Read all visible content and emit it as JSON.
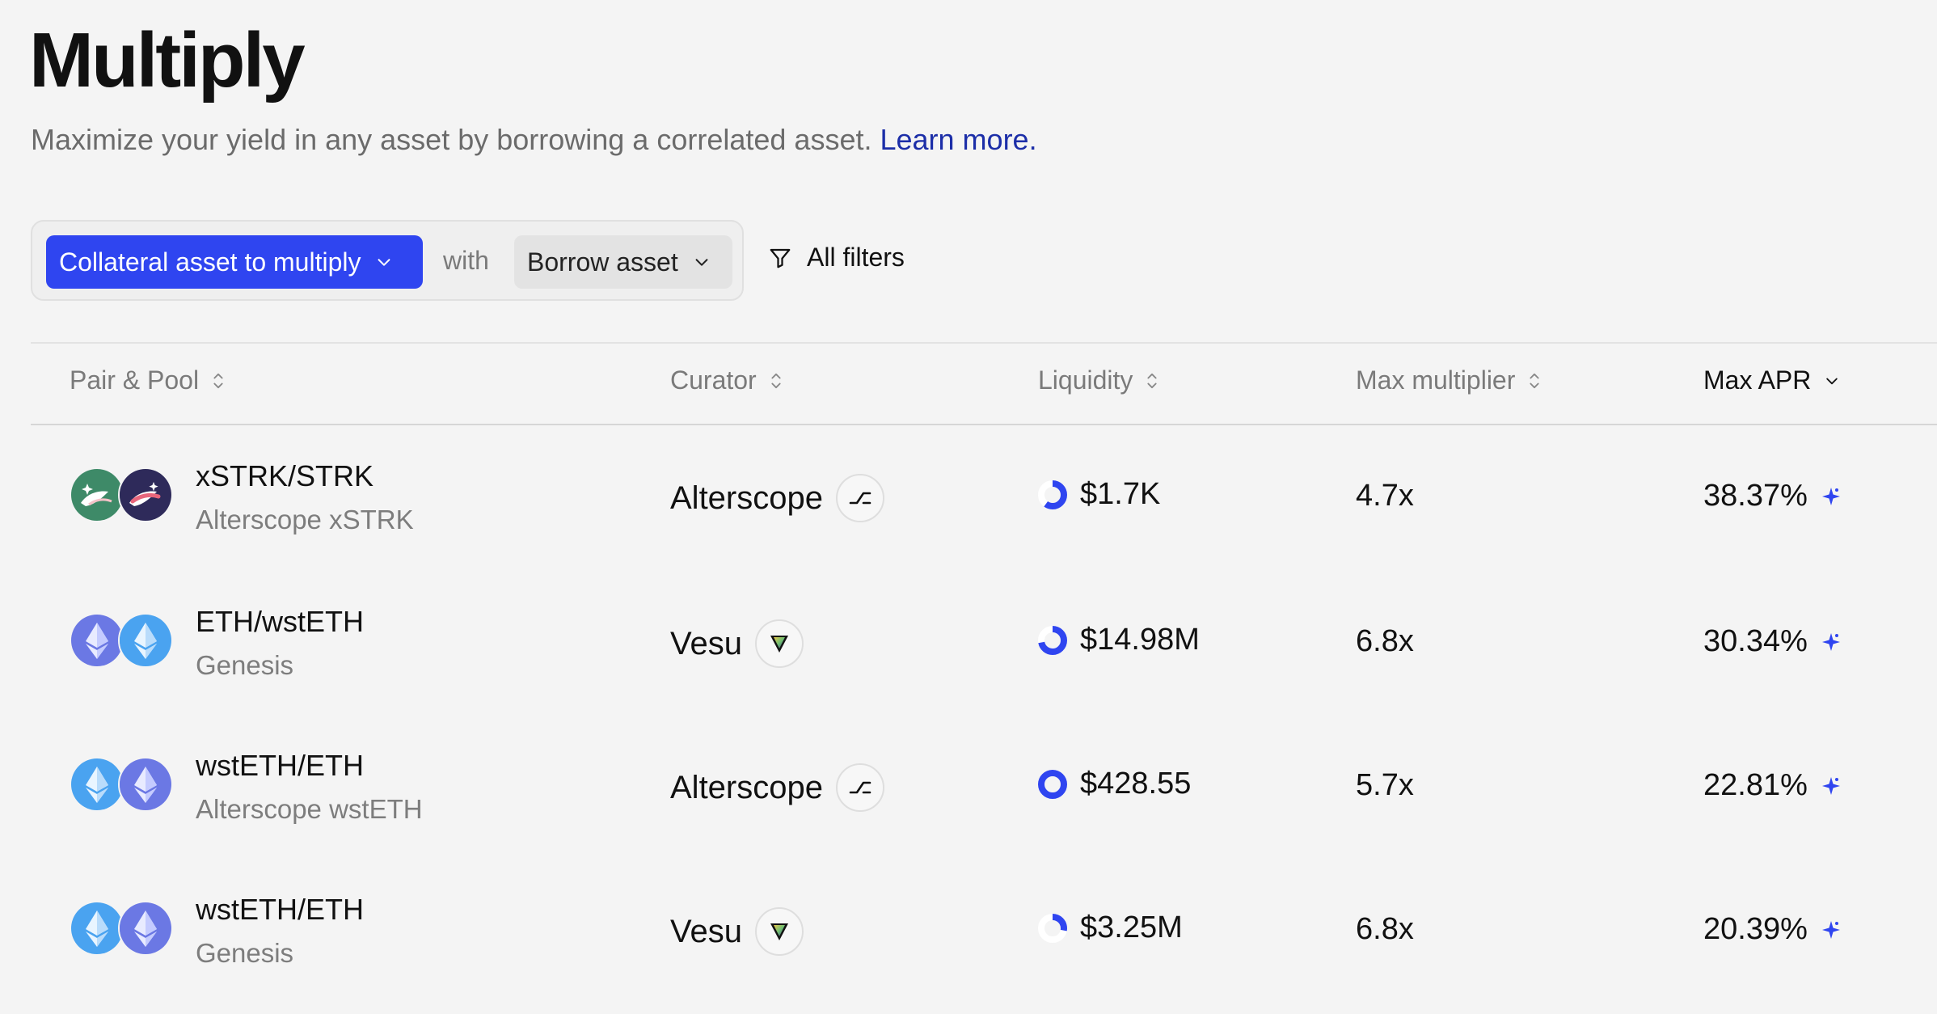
{
  "header": {
    "title": "Multiply",
    "subtitle": "Maximize your yield in any asset by borrowing a correlated asset.",
    "learn_more": "Learn more."
  },
  "filters": {
    "collateral_label": "Collateral asset to multiply",
    "with_label": "with",
    "borrow_label": "Borrow asset",
    "all_filters_label": "All filters"
  },
  "table": {
    "columns": {
      "pair_pool": "Pair & Pool",
      "curator": "Curator",
      "liquidity": "Liquidity",
      "max_multiplier": "Max multiplier",
      "max_apr": "Max APR"
    },
    "rows": [
      {
        "pair": "xSTRK/STRK",
        "pool": "Alterscope xSTRK",
        "curator": "Alterscope",
        "curator_icon": "alterscope-icon",
        "liquidity": "$1.7K",
        "liquidity_utilization": 0.6,
        "max_multiplier": "4.7x",
        "max_apr": "38.37%",
        "coin_icons": [
          "xstrk-icon",
          "strk-icon"
        ]
      },
      {
        "pair": "ETH/wstETH",
        "pool": "Genesis",
        "curator": "Vesu",
        "curator_icon": "vesu-icon",
        "liquidity": "$14.98M",
        "liquidity_utilization": 0.72,
        "max_multiplier": "6.8x",
        "max_apr": "30.34%",
        "coin_icons": [
          "eth-icon",
          "wsteth-icon"
        ]
      },
      {
        "pair": "wstETH/ETH",
        "pool": "Alterscope wstETH",
        "curator": "Alterscope",
        "curator_icon": "alterscope-icon",
        "liquidity": "$428.55",
        "liquidity_utilization": 1.0,
        "max_multiplier": "5.7x",
        "max_apr": "22.81%",
        "coin_icons": [
          "wsteth-icon",
          "eth-icon"
        ]
      },
      {
        "pair": "wstETH/ETH",
        "pool": "Genesis",
        "curator": "Vesu",
        "curator_icon": "vesu-icon",
        "liquidity": "$3.25M",
        "liquidity_utilization": 0.28,
        "max_multiplier": "6.8x",
        "max_apr": "20.39%",
        "coin_icons": [
          "wsteth-icon",
          "eth-icon"
        ]
      }
    ]
  },
  "colors": {
    "accent": "#2f45f0",
    "link": "#1c2ea8",
    "background": "#f4f4f4"
  }
}
